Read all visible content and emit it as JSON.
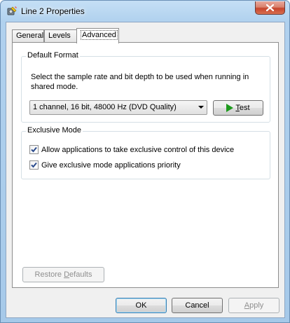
{
  "window": {
    "title": "Line 2 Properties"
  },
  "tabs": [
    {
      "label": "General"
    },
    {
      "label": "Levels"
    },
    {
      "label": "Advanced"
    }
  ],
  "default_format": {
    "group_label": "Default Format",
    "description": "Select the sample rate and bit depth to be used when running in shared mode.",
    "selected_format": "1 channel, 16 bit, 48000 Hz (DVD Quality)",
    "test_label_prefix": "",
    "test_label_accel": "T",
    "test_label_rest": "est"
  },
  "exclusive_mode": {
    "group_label": "Exclusive Mode",
    "options": [
      {
        "label": "Allow applications to take exclusive control of this device",
        "checked": true
      },
      {
        "label": "Give exclusive mode applications priority",
        "checked": true
      }
    ]
  },
  "restore": {
    "prefix": "Restore ",
    "accel": "D",
    "rest": "efaults"
  },
  "footer": {
    "ok": "OK",
    "cancel_accel": "",
    "cancel": "Cancel",
    "apply_accel": "A",
    "apply_rest": "pply"
  }
}
